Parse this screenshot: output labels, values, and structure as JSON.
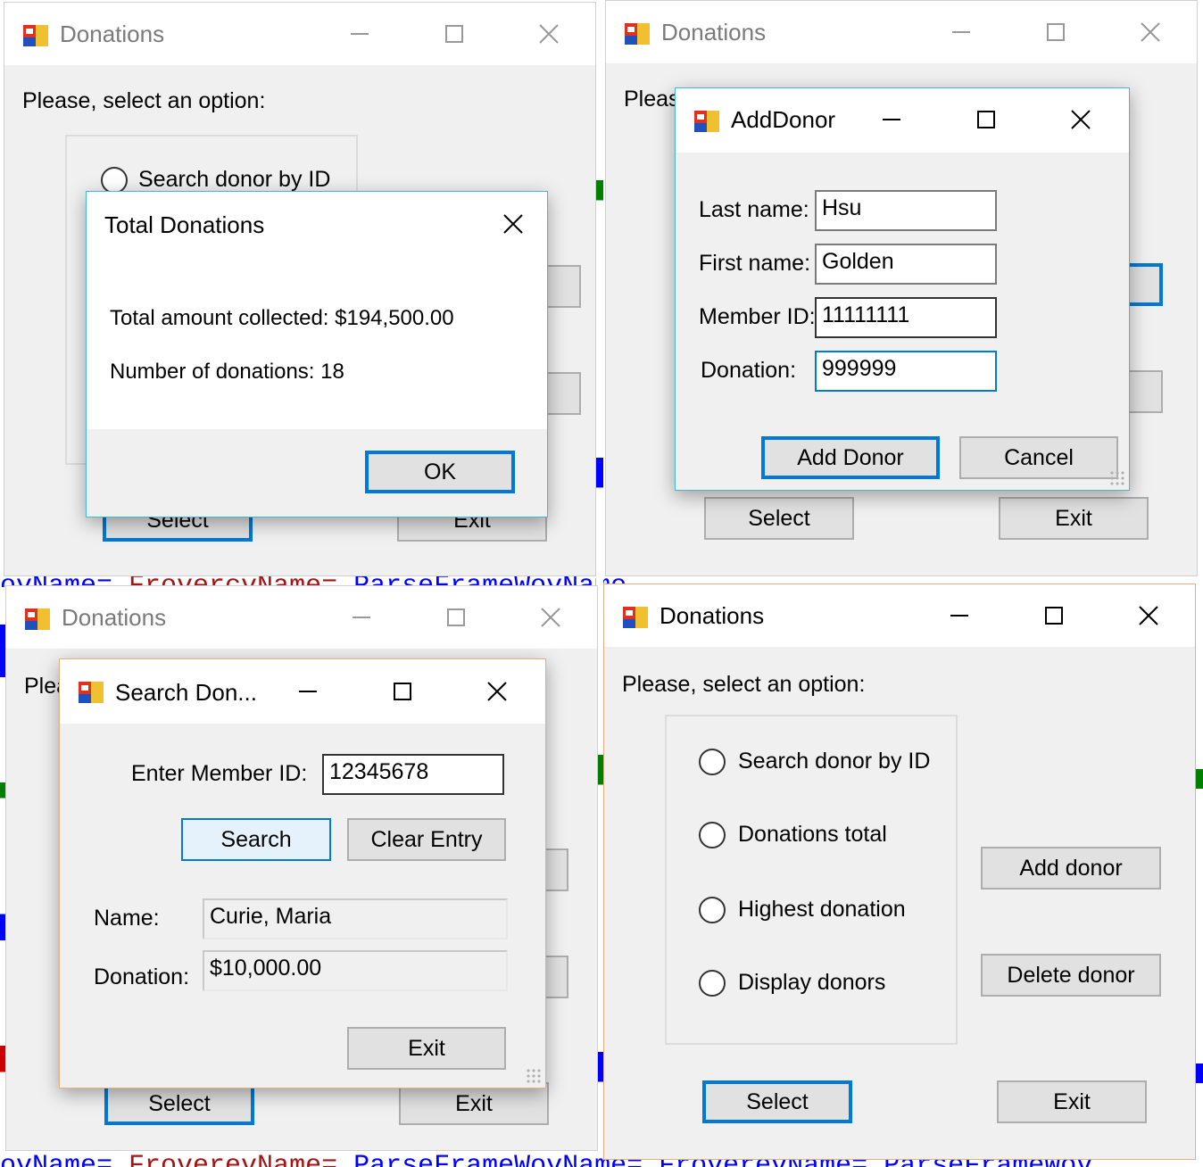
{
  "colors": {
    "accent": "#0078d7",
    "dialog_border_blue": "#46b8cf",
    "dialog_border_orange": "#e0b080",
    "window_bg": "#f0f0f0",
    "button_bg": "#e1e1e1",
    "code_blue": "#0000ff",
    "code_red": "#a31515"
  },
  "icons": {
    "app": "windows-forms-app-icon",
    "minimize": "minimize-icon",
    "maximize": "maximize-icon",
    "close": "close-icon"
  },
  "panel1": {
    "window_title": "Donations",
    "prompt": "Please, select an option:",
    "radio_search": "Search donor by ID",
    "select_btn": "Select",
    "exit_btn": "Exit",
    "dialog": {
      "title": "Total Donations",
      "total_line": "Total amount collected: $194,500.00",
      "count_line": "Number of donations: 18",
      "ok_btn": "OK"
    }
  },
  "panel2": {
    "window_title": "Donations",
    "prompt_partial": "Pleas",
    "select_btn": "Select",
    "exit_btn": "Exit",
    "dialog": {
      "title": "AddDonor",
      "last_name_label": "Last name:",
      "last_name_value": "Hsu",
      "first_name_label": "First name:",
      "first_name_value": "Golden",
      "member_id_label": "Member ID:",
      "member_id_value": "11111111",
      "donation_label": "Donation:",
      "donation_value": "999999",
      "add_btn": "Add Donor",
      "cancel_btn": "Cancel"
    }
  },
  "panel3": {
    "window_title": "Donations",
    "prompt_partial": "Plea",
    "select_btn": "Select",
    "exit_btn": "Exit",
    "dialog": {
      "title": "Search Don...",
      "member_id_label": "Enter Member ID:",
      "member_id_value": "12345678",
      "search_btn": "Search",
      "clear_btn": "Clear Entry",
      "name_label": "Name:",
      "name_value": "Curie, Maria",
      "donation_label": "Donation:",
      "donation_value": "$10,000.00",
      "exit_btn": "Exit"
    }
  },
  "panel4": {
    "window_title": "Donations",
    "prompt": "Please, select an option:",
    "options": [
      "Search donor by ID",
      "Donations total",
      "Highest donation",
      "Display donors"
    ],
    "add_btn": "Add donor",
    "delete_btn": "Delete donor",
    "select_btn": "Select",
    "exit_btn": "Exit"
  }
}
